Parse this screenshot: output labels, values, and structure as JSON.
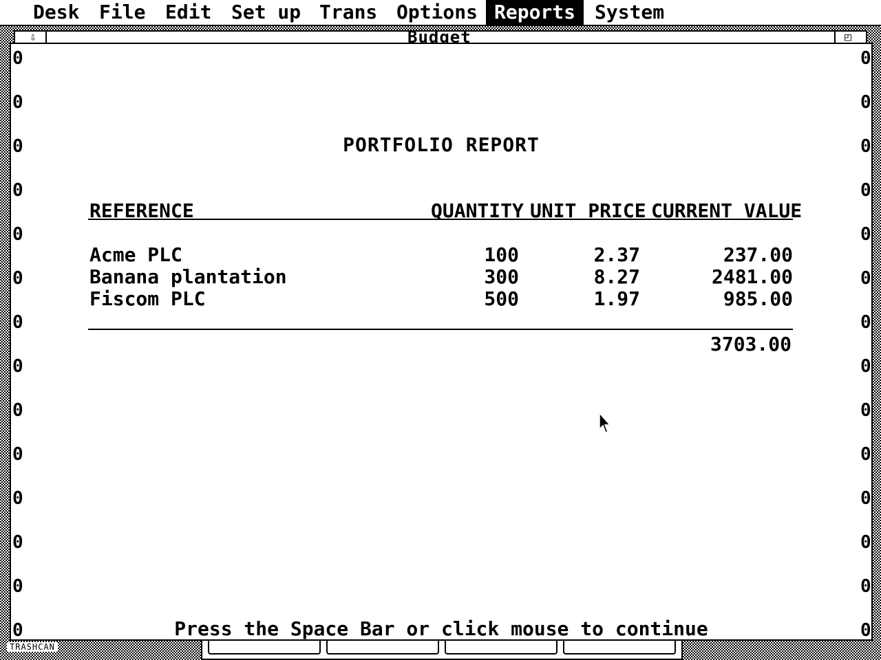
{
  "menubar": {
    "items": [
      "Desk",
      "File",
      "Edit",
      "Set up",
      "Trans",
      "Options",
      "Reports",
      "System"
    ],
    "active": "Reports"
  },
  "background_window": {
    "title": "Budget"
  },
  "desktop": {
    "trash_label": "TRASHCAN"
  },
  "report": {
    "title": "PORTFOLIO REPORT",
    "columns": {
      "reference": "REFERENCE",
      "quantity": "QUANTITY",
      "unit_price": "UNIT PRICE",
      "current_value": "CURRENT VALUE"
    },
    "rows": [
      {
        "reference": "Acme PLC",
        "quantity": "100",
        "unit_price": "2.37",
        "current_value": "237.00"
      },
      {
        "reference": "Banana plantation",
        "quantity": "300",
        "unit_price": "8.27",
        "current_value": "2481.00"
      },
      {
        "reference": "Fiscom PLC",
        "quantity": "500",
        "unit_price": "1.97",
        "current_value": "985.00"
      }
    ],
    "total": "3703.00",
    "margin_marker": "0",
    "prompt": "Press the Space Bar or click mouse to continue"
  }
}
